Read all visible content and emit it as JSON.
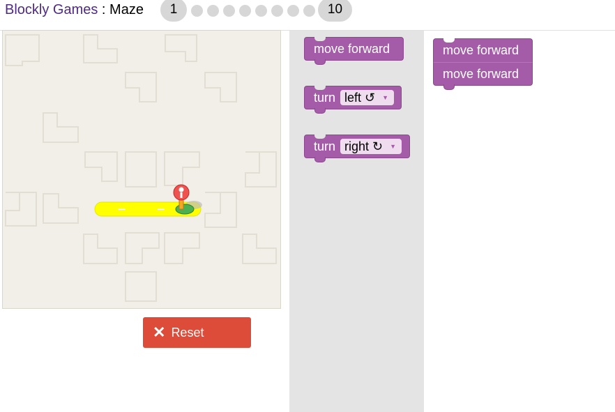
{
  "header": {
    "app_name": "Blockly Games",
    "separator": " : ",
    "game_name": "Maze",
    "levels": {
      "first": "1",
      "last": "10",
      "dots": 8
    }
  },
  "maze": {
    "path_color": "#ffff00",
    "background": "#f1efe8"
  },
  "controls": {
    "reset_label": "Reset"
  },
  "toolbox": {
    "blocks": [
      {
        "label": "move forward"
      },
      {
        "label": "turn",
        "dropdown": "left ↺"
      },
      {
        "label": "turn",
        "dropdown": "right ↻"
      }
    ]
  },
  "workspace": {
    "blocks": [
      {
        "label": "move forward"
      },
      {
        "label": "move forward"
      }
    ]
  },
  "colors": {
    "block": "#a55ca8",
    "reset": "#dd4b39",
    "title_link": "#4e2a84"
  }
}
